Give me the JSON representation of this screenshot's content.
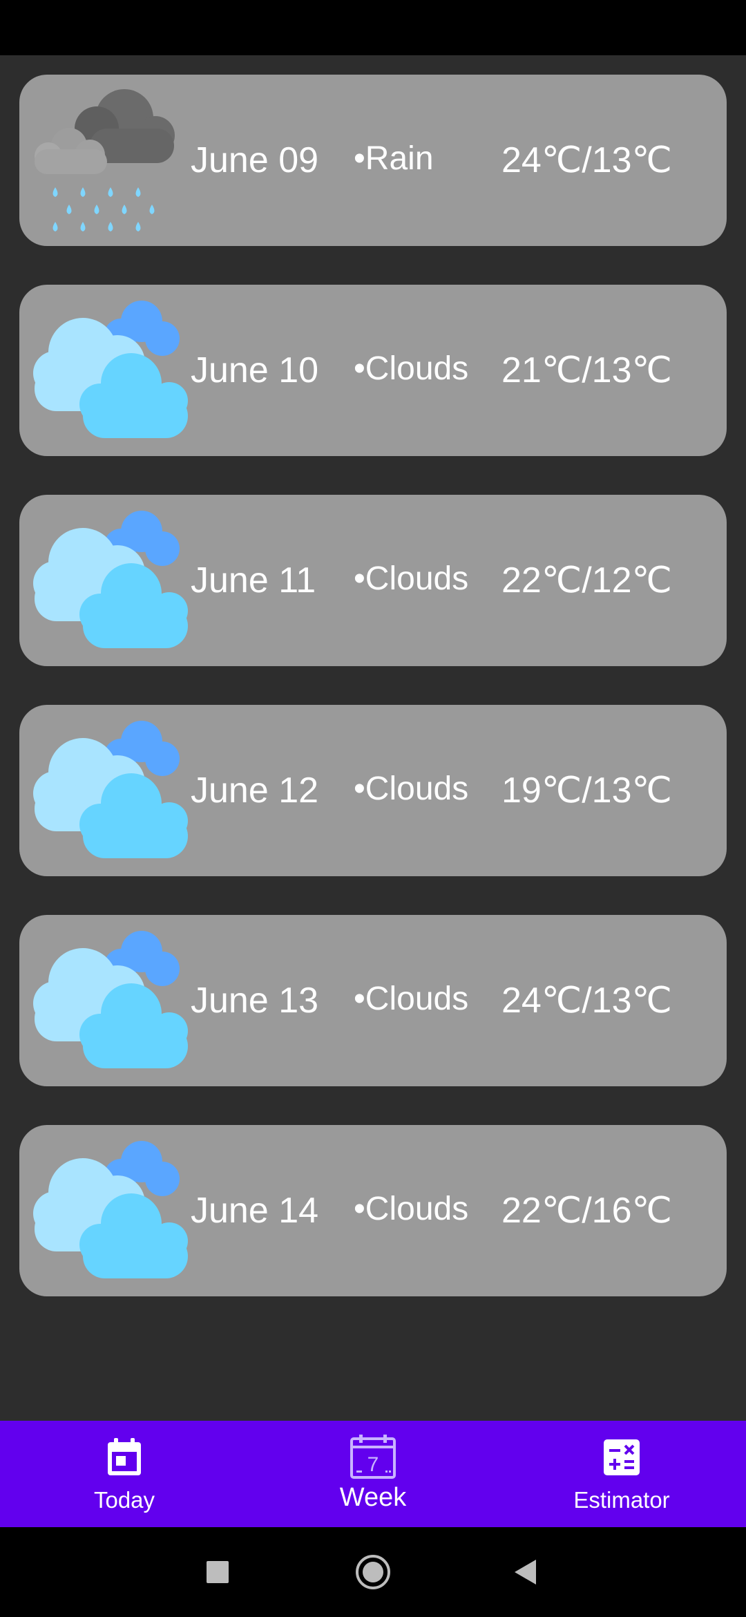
{
  "forecast": [
    {
      "date": "June 09",
      "condition": "•Rain",
      "temp": "24℃/13℃",
      "icon": "rain-cloud-icon"
    },
    {
      "date": "June 10",
      "condition": "•Clouds",
      "temp": "21℃/13℃",
      "icon": "clouds-icon"
    },
    {
      "date": "June 11",
      "condition": "•Clouds",
      "temp": "22℃/12℃",
      "icon": "clouds-icon"
    },
    {
      "date": "June 12",
      "condition": "•Clouds",
      "temp": "19℃/13℃",
      "icon": "clouds-icon"
    },
    {
      "date": "June 13",
      "condition": "•Clouds",
      "temp": "24℃/13℃",
      "icon": "clouds-icon"
    },
    {
      "date": "June 14",
      "condition": "•Clouds",
      "temp": "22℃/16℃",
      "icon": "clouds-icon"
    }
  ],
  "bottom_nav": {
    "items": [
      {
        "label": "Today",
        "icon": "calendar-today-icon"
      },
      {
        "label": "Week",
        "icon": "calendar-week-icon",
        "active": true
      },
      {
        "label": "Estimator",
        "icon": "calculator-icon"
      }
    ]
  },
  "colors": {
    "background": "#2d2d2d",
    "card": "#9a9a9a",
    "nav": "#6200ee"
  }
}
